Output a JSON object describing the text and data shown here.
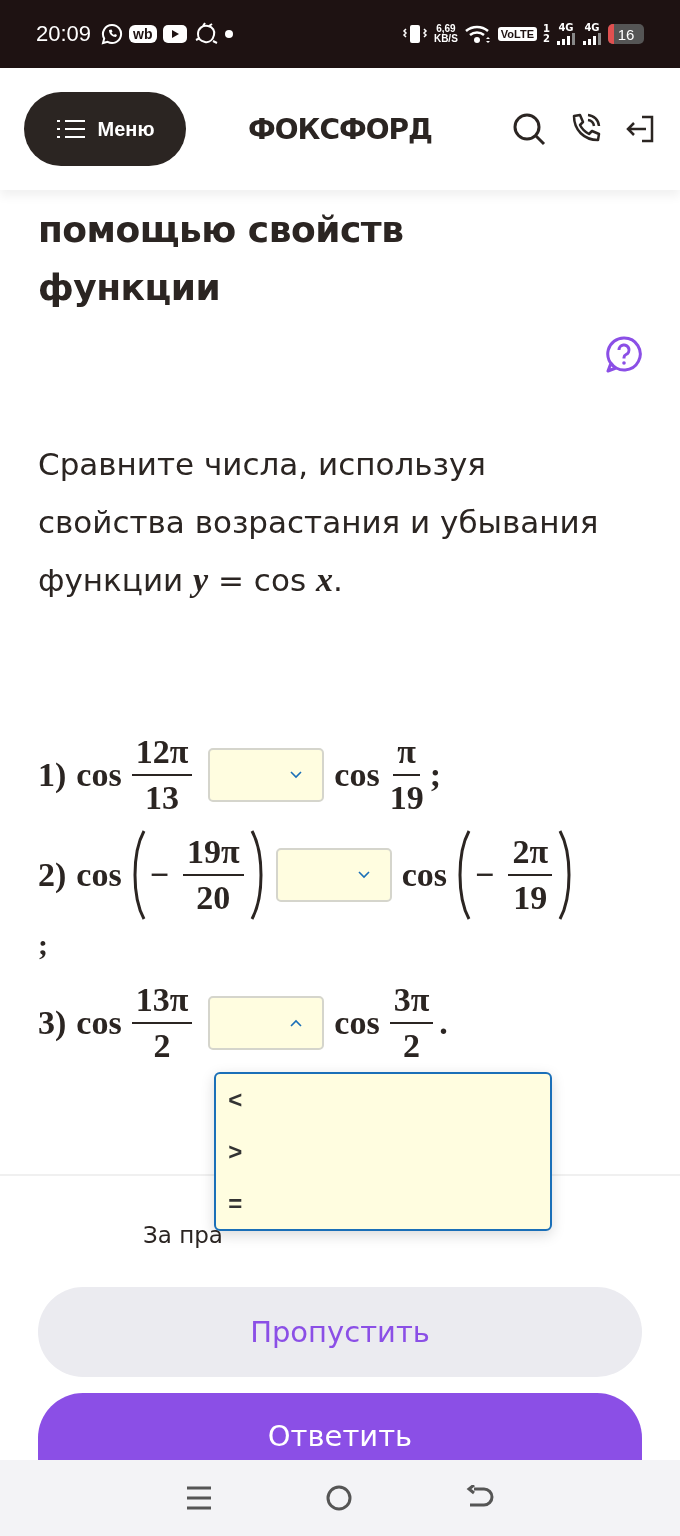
{
  "status_bar": {
    "time": "20:09",
    "app_badge": "wb",
    "net_speed": "6,69",
    "net_unit": "KB/S",
    "volte": "VoLTE",
    "sim_slots": [
      "1",
      "2"
    ],
    "signals": [
      {
        "label": "4G"
      },
      {
        "label": "4G"
      }
    ],
    "battery": "16"
  },
  "header": {
    "menu_button": "Меню",
    "logo": "ФОКСФОРД"
  },
  "task": {
    "title_lines": [
      "помощью свойств",
      "функции"
    ],
    "question": "Сравните числа, используя свойства возрастания и убывания функции *y* = cos *x*.",
    "rows": [
      {
        "number": "1)",
        "left": {
          "func": "cos",
          "parens": false,
          "num": "12π",
          "den": "13"
        },
        "select": {
          "expanded": false
        },
        "right": {
          "func": "cos",
          "parens": false,
          "num": "π",
          "den": "19"
        },
        "end": ";",
        "end_on_new_line": false
      },
      {
        "number": "2)",
        "left": {
          "func": "cos",
          "parens": true,
          "sign": "−",
          "num": "19π",
          "den": "20"
        },
        "select": {
          "expanded": false
        },
        "right": {
          "func": "cos",
          "parens": true,
          "sign": "−",
          "num": "2π",
          "den": "19"
        },
        "end": ";",
        "end_on_new_line": true
      },
      {
        "number": "3)",
        "left": {
          "func": "cos",
          "parens": false,
          "num": "13π",
          "den": "2"
        },
        "select": {
          "expanded": true,
          "options": [
            {
              "label": "<",
              "selected": false
            },
            {
              "label": ">",
              "selected": false
            },
            {
              "label": "=",
              "selected": false
            }
          ]
        },
        "right": {
          "func": "cos",
          "parens": false,
          "num": "3π",
          "den": "2"
        },
        "end": ".",
        "end_on_new_line": false
      }
    ]
  },
  "footer": {
    "note": "За пра",
    "buttons": [
      {
        "label": "Пропустить",
        "kind": "secondary"
      },
      {
        "label": "Ответить",
        "kind": "primary"
      }
    ]
  }
}
